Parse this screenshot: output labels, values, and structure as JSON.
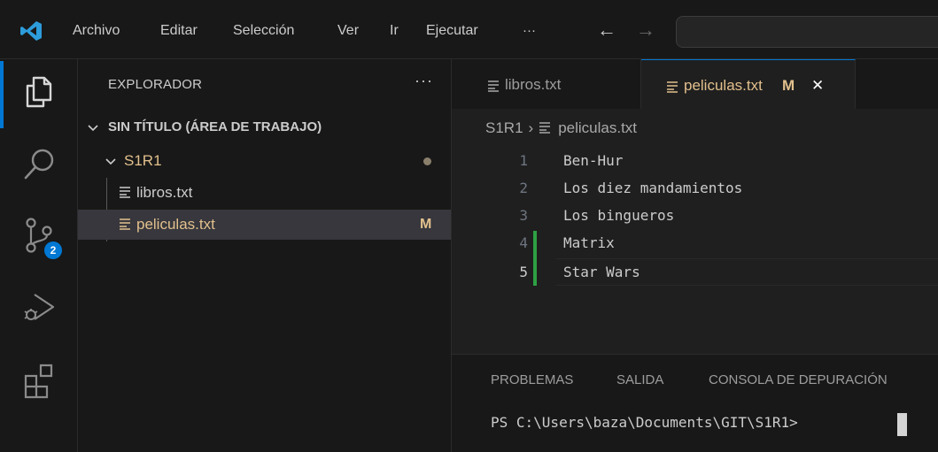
{
  "menu": {
    "items": [
      "Archivo",
      "Editar",
      "Selección",
      "Ver",
      "Ir",
      "Ejecutar"
    ],
    "more": "···"
  },
  "nav": {
    "back": "←",
    "forward": "→"
  },
  "activity": {
    "source_control_badge": "2"
  },
  "explorer": {
    "title": "EXPLORADOR",
    "more": "···",
    "workspace": "SIN TÍTULO (ÁREA DE TRABAJO)",
    "folder": "S1R1",
    "files": [
      {
        "name": "libros.txt",
        "status": ""
      },
      {
        "name": "peliculas.txt",
        "status": "M"
      }
    ]
  },
  "tabs": [
    {
      "label": "libros.txt",
      "status": ""
    },
    {
      "label": "peliculas.txt",
      "status": "M",
      "close": "✕"
    }
  ],
  "breadcrumb": {
    "folder": "S1R1",
    "separator": "›",
    "file": "peliculas.txt"
  },
  "editor": {
    "lines": [
      {
        "number": "1",
        "text": "Ben-Hur"
      },
      {
        "number": "2",
        "text": "Los diez mandamientos"
      },
      {
        "number": "3",
        "text": "Los bingueros"
      },
      {
        "number": "4",
        "text": "Matrix"
      },
      {
        "number": "5",
        "text": "Star Wars"
      }
    ]
  },
  "panel": {
    "tabs": [
      "PROBLEMAS",
      "SALIDA",
      "CONSOLA DE DEPURACIÓN"
    ],
    "terminal_prompt": "PS C:\\Users\\baza\\Documents\\GIT\\S1R1>"
  },
  "colors": {
    "accent": "#0078d4",
    "modified": "#e2c08d",
    "added_gutter": "#2ea043",
    "background": "#1f1f1f"
  }
}
